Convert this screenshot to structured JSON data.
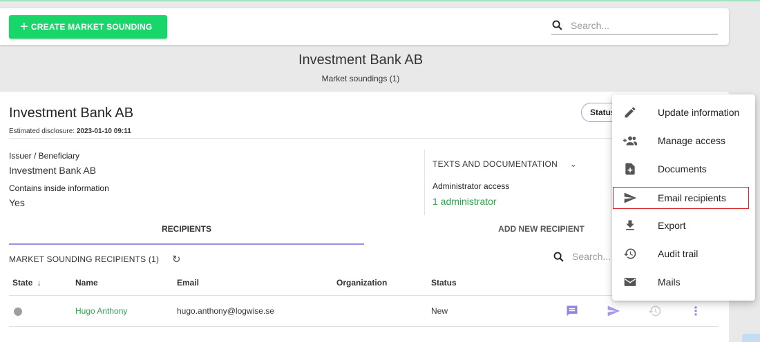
{
  "topbar": {
    "create_button": "CREATE MARKET SOUNDING",
    "search_placeholder": "Search..."
  },
  "header": {
    "title": "Investment Bank AB",
    "subtitle": "Market soundings (1)"
  },
  "card": {
    "title": "Investment Bank AB",
    "disclosure_label": "Estimated disclosure:",
    "disclosure_value": "2023-01-10 09:11",
    "status_pill": "Status",
    "issuer_label": "Issuer / Beneficiary",
    "issuer_value": "Investment Bank AB",
    "inside_label": "Contains inside information",
    "inside_value": "Yes",
    "texts_doc": "TEXTS AND DOCUMENTATION",
    "admin_label": "Administrator access",
    "admin_value": "1 administrator"
  },
  "tabs": {
    "recipients": "RECIPIENTS",
    "add_new": "ADD NEW RECIPIENT"
  },
  "recipients": {
    "list_title": "MARKET SOUNDING RECIPIENTS (1)",
    "search_placeholder": "Search...",
    "columns": {
      "state": "State",
      "name": "Name",
      "email": "Email",
      "organization": "Organization",
      "status": "Status"
    },
    "rows": [
      {
        "name": "Hugo Anthony",
        "email": "hugo.anthony@logwise.se",
        "organization": "",
        "status": "New"
      }
    ]
  },
  "menu": {
    "items": [
      {
        "label": "Update information",
        "icon": "pencil-icon"
      },
      {
        "label": "Manage access",
        "icon": "group-add-icon"
      },
      {
        "label": "Documents",
        "icon": "document-add-icon"
      },
      {
        "label": "Email recipients",
        "icon": "send-icon"
      },
      {
        "label": "Export",
        "icon": "download-icon"
      },
      {
        "label": "Audit trail",
        "icon": "history-icon"
      },
      {
        "label": "Mails",
        "icon": "mail-icon"
      }
    ]
  },
  "colors": {
    "accent_green": "#19d66a",
    "link_green": "#2fa44f",
    "accent_purple": "#9c8ee0",
    "highlight_red": "#d9262c"
  }
}
